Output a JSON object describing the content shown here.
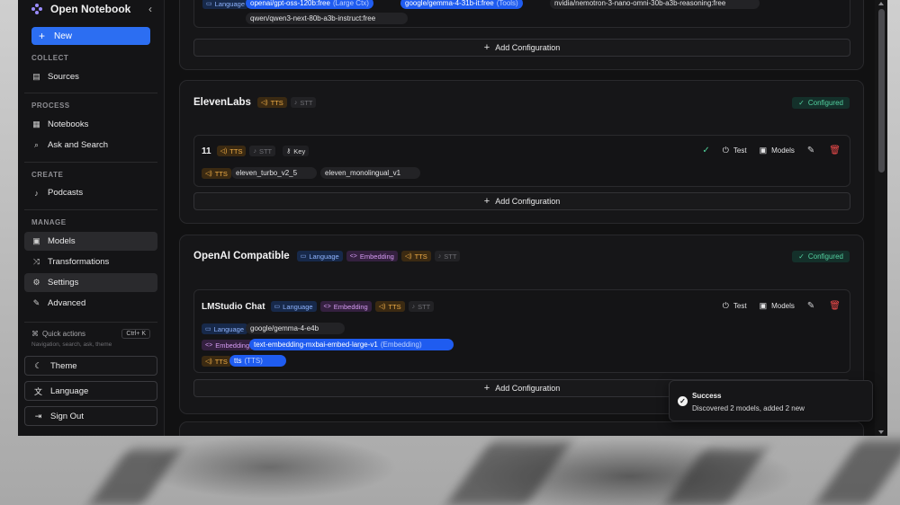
{
  "sidebar": {
    "brand": "Open Notebook",
    "new_label": "New",
    "sections": {
      "collect": "COLLECT",
      "process": "PROCESS",
      "create": "CREATE",
      "manage": "MANAGE"
    },
    "items": {
      "sources": "Sources",
      "notebooks": "Notebooks",
      "ask_search": "Ask and Search",
      "podcasts": "Podcasts",
      "models": "Models",
      "transformations": "Transformations",
      "settings": "Settings",
      "advanced": "Advanced"
    },
    "quick_actions": {
      "label": "Quick actions",
      "shortcut": "Ctrl+ K",
      "hint": "Navigation, search, ask, theme"
    },
    "bottom": {
      "theme": "Theme",
      "language": "Language",
      "sign_out": "Sign Out"
    }
  },
  "badges": {
    "language": "Language",
    "embedding": "Embedding",
    "tts": "TTS",
    "stt": "STT",
    "key": "Key"
  },
  "top_card": {
    "models_row1": [
      {
        "name": "openai/gpt-oss-120b:free",
        "cap": "(Large Ctx)",
        "selected": true
      },
      {
        "name": "google/gemma-4-31b-it:free",
        "cap": "(Tools)",
        "selected": true
      },
      {
        "name": "nvidia/nemotron-3-nano-omni-30b-a3b-reasoning:free",
        "cap": "",
        "selected": false
      }
    ],
    "models_row2": [
      {
        "name": "qwen/qwen3-next-80b-a3b-instruct:free",
        "cap": "",
        "selected": false
      }
    ],
    "add_label": "Add Configuration"
  },
  "elevenlabs": {
    "title": "ElevenLabs",
    "status": "Configured",
    "config": {
      "name": "11",
      "test": "Test",
      "models": "Models",
      "tts_models": [
        "eleven_turbo_v2_5",
        "eleven_monolingual_v1"
      ]
    },
    "add_label": "Add Configuration"
  },
  "openai_compat": {
    "title": "OpenAI Compatible",
    "status": "Configured",
    "config": {
      "name": "LMStudio Chat",
      "test": "Test",
      "models": "Models",
      "language_model": "google/gemma-4-e4b",
      "embedding_model": "text-embedding-mxbai-embed-large-v1",
      "embedding_cap": "(Embedding)",
      "tts_model": "tts",
      "tts_cap": "(TTS)"
    },
    "add_label": "Add Configuration"
  },
  "toast": {
    "title": "Success",
    "message": "Discovered 2 models, added 2 new"
  },
  "colors": {
    "accent": "#2c6ef2",
    "configured": "#53d1a0",
    "tts": "#f0ad46",
    "embedding": "#d59bf2",
    "language": "#8fb4ff",
    "delete": "#ef4b4b"
  }
}
